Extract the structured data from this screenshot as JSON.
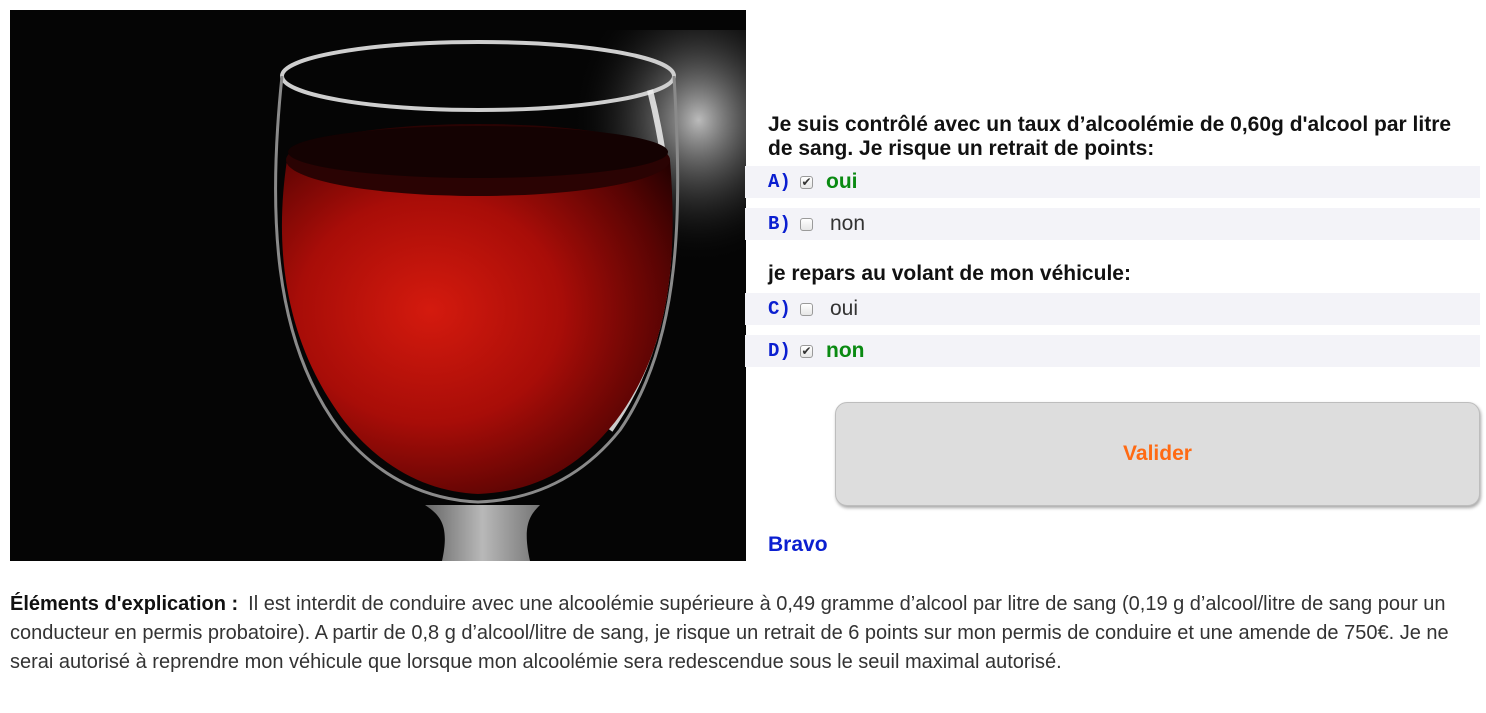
{
  "image": {
    "subject": "red wine glass on black background"
  },
  "questions": [
    {
      "text": "Je suis contrôlé avec un taux d’alcoolémie de 0,60g d'alcool par litre de sang. Je risque un retrait de points:",
      "answers": [
        {
          "letter": "A)",
          "label": "oui",
          "checked": true,
          "correct": true
        },
        {
          "letter": "B)",
          "label": "non",
          "checked": false,
          "correct": false
        }
      ]
    },
    {
      "text": "je repars au volant de mon véhicule:",
      "answers": [
        {
          "letter": "C)",
          "label": "oui",
          "checked": false,
          "correct": false
        },
        {
          "letter": "D)",
          "label": "non",
          "checked": true,
          "correct": true
        }
      ]
    }
  ],
  "submit_label": "Valider",
  "feedback": "Bravo",
  "explanation": {
    "label": "Éléments d'explication :",
    "text": "Il est interdit de conduire avec une alcoolémie supérieure à 0,49 gramme d’alcool par litre de sang (0,19 g d’alcool/litre de sang pour un conducteur en permis probatoire). A partir de 0,8 g d’alcool/litre de sang, je risque un retrait de 6 points sur mon permis de conduire et une amende de 750€. Je ne serai autorisé à reprendre mon véhicule que lorsque mon alcoolémie sera redescendue sous le seuil maximal autorisé."
  },
  "colors": {
    "letter": "#0b1fd0",
    "correct_answer": "#0a8a12",
    "submit_text": "#ff6a13",
    "feedback": "#0b1fd0",
    "answer_row_bg": "#f3f3f8"
  },
  "icons": {
    "checked": "checkbox-checked-icon",
    "unchecked": "checkbox-empty-icon"
  }
}
